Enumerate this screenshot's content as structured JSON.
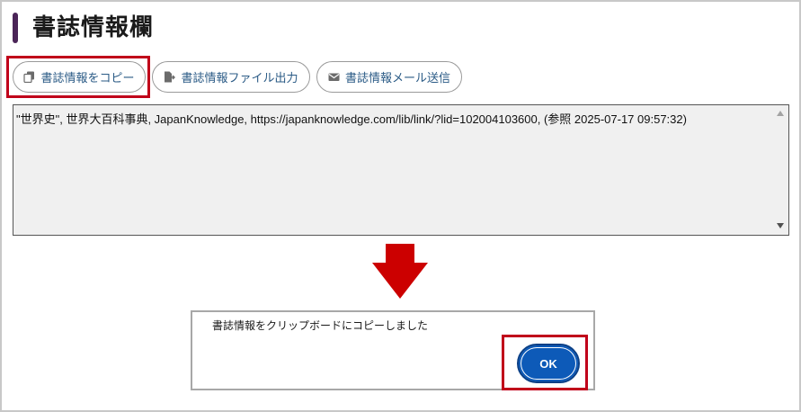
{
  "section": {
    "title": "書誌情報欄"
  },
  "toolbar": {
    "copy_label": "書誌情報をコピー",
    "copy_icon": "copy-icon",
    "file_label": "書誌情報ファイル出力",
    "file_icon": "file-export-icon",
    "mail_label": "書誌情報メール送信",
    "mail_icon": "envelope-icon"
  },
  "citation": {
    "text": "\"世界史\", 世界大百科事典, JapanKnowledge, https://japanknowledge.com/lib/link/?lid=102004103600, (参照 2025-07-17 09:57:32)"
  },
  "dialog": {
    "message": "書誌情報をクリップボードにコピーしました",
    "ok_label": "OK"
  },
  "colors": {
    "accent_bar": "#4b2558",
    "button_text": "#2b5b86",
    "highlight": "#c0001a",
    "arrow": "#cc0000",
    "ok_button": "#0d5ab8"
  }
}
